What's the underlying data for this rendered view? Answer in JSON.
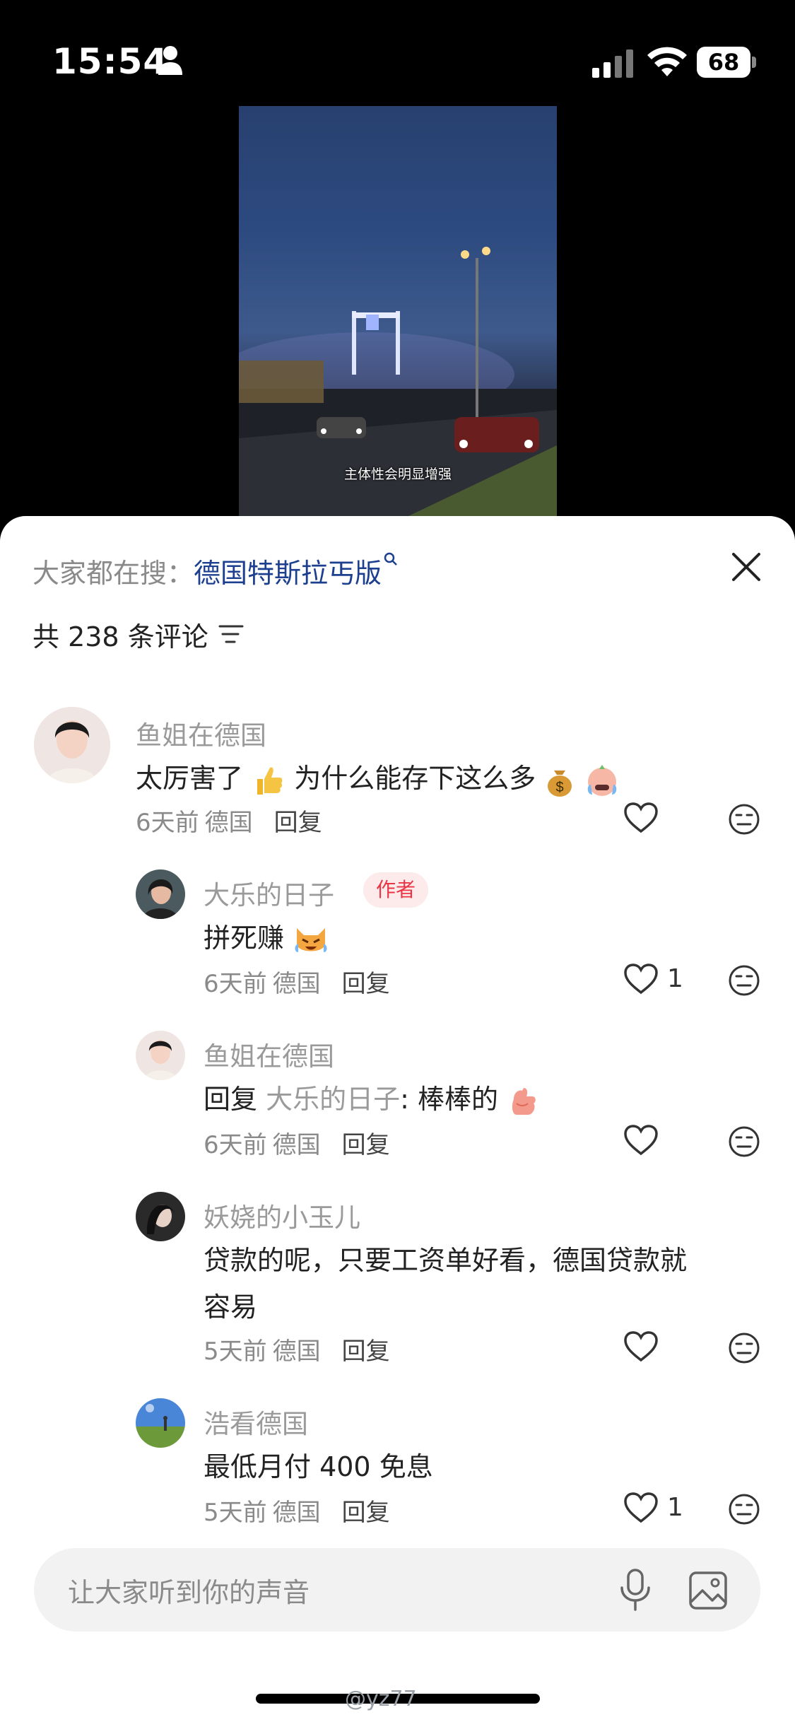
{
  "status_bar": {
    "time": "15:54",
    "battery": "68"
  },
  "video": {
    "caption": "主体性会明显增强"
  },
  "search": {
    "label": "大家都在搜：",
    "term": "德国特斯拉丐版"
  },
  "comments_header": {
    "count_text": "共 238 条评论"
  },
  "comments": [
    {
      "name": "鱼姐在德国",
      "text": "太厉害了",
      "text2": "为什么能存下这么多",
      "time": "6天前",
      "location": "德国",
      "reply_label": "回复",
      "likes": ""
    },
    {
      "name": "大乐的日子",
      "badge": "作者",
      "text": "拼死赚",
      "time": "6天前",
      "location": "德国",
      "reply_label": "回复",
      "likes": "1"
    },
    {
      "name": "鱼姐在德国",
      "reply_prefix": "回复",
      "reply_to": "大乐的日子",
      "text": ": 棒棒的",
      "time": "6天前",
      "location": "德国",
      "reply_label": "回复",
      "likes": ""
    },
    {
      "name": "妖娆的小玉儿",
      "text": "贷款的呢，只要工资单好看，德国贷款就",
      "text2": "容易",
      "time": "5天前",
      "location": "德国",
      "reply_label": "回复",
      "likes": ""
    },
    {
      "name": "浩看德国",
      "text": "最低月付 400 免息",
      "time": "5天前",
      "location": "德国",
      "reply_label": "回复",
      "likes": "1"
    }
  ],
  "input": {
    "placeholder": "让大家听到你的声音"
  },
  "watermark": "@yz77",
  "colors": {
    "search_term": "#1d3f8f",
    "author_badge": "#ea3546",
    "muted_text": "#9a9a9a"
  }
}
